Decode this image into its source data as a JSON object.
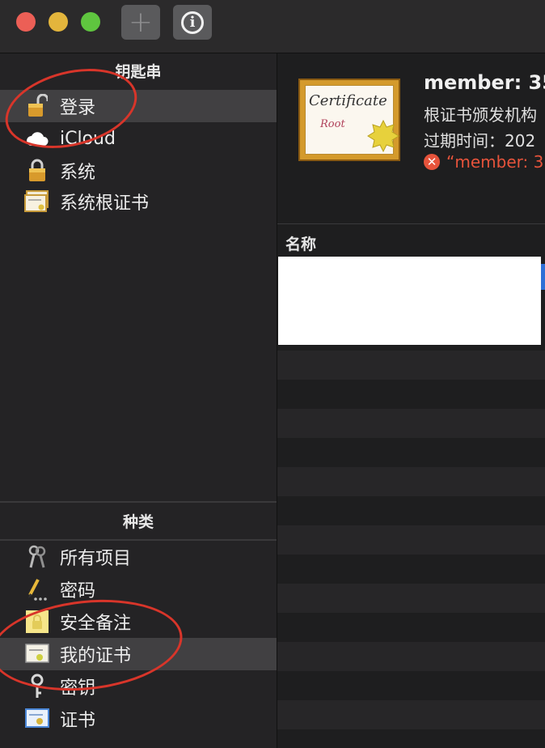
{
  "toolbar": {
    "add_icon": "plus-icon",
    "info_icon": "info-icon",
    "add_glyph": "+",
    "info_glyph": "i"
  },
  "sidebar": {
    "keychains_title": "钥匙串",
    "keychains": [
      {
        "label": "登录",
        "icon": "unlocked-padlock-icon",
        "selected": true
      },
      {
        "label": "iCloud",
        "icon": "cloud-icon"
      },
      {
        "label": "系统",
        "icon": "padlock-icon"
      },
      {
        "label": "系统根证书",
        "icon": "certificate-icon"
      }
    ],
    "category_title": "种类",
    "categories": [
      {
        "label": "所有项目",
        "icon": "keys-icon"
      },
      {
        "label": "密码",
        "icon": "pencil-icon"
      },
      {
        "label": "安全备注",
        "icon": "secure-note-icon"
      },
      {
        "label": "我的证书",
        "icon": "my-certificate-icon",
        "selected": true
      },
      {
        "label": "密钥",
        "icon": "key-icon"
      },
      {
        "label": "证书",
        "icon": "certificate-icon"
      }
    ]
  },
  "certificate": {
    "badge_word": "Certificate",
    "badge_sub": "Root",
    "title": "member: 35",
    "issuer_line": "根证书颁发机构",
    "expiry_line": "过期时间：202",
    "error_text": "“member: 3"
  },
  "list": {
    "column_name": "名称"
  },
  "colors": {
    "close": "#ec5f56",
    "minimize": "#e3b53c",
    "zoom": "#5fc53f",
    "annotation": "#d8352a",
    "error": "#e6533b"
  }
}
